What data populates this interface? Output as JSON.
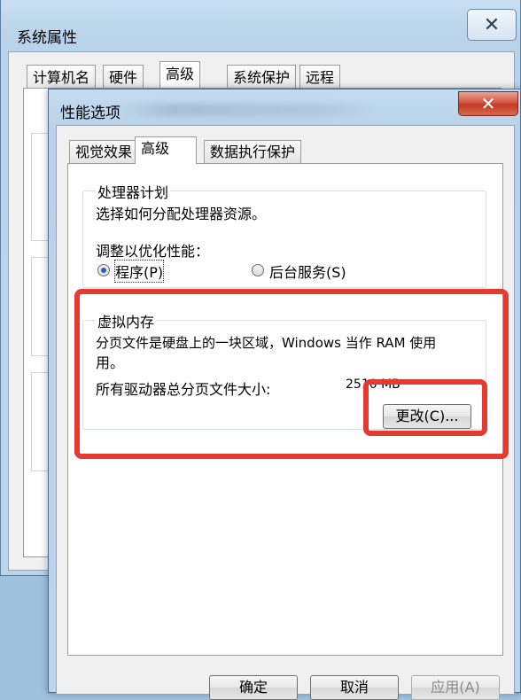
{
  "outer_window": {
    "title": "系统属性",
    "close_glyph": "✕",
    "tabs": [
      "计算机名",
      "硬件",
      "高级",
      "系统保护",
      "远程"
    ],
    "selected_tab": "高级"
  },
  "inner_window": {
    "title": "性能选项",
    "close_glyph": "✕",
    "tabs": [
      "视觉效果",
      "高级",
      "数据执行保护"
    ],
    "selected_tab": "高级",
    "processor_scheduling": {
      "title": "处理器计划",
      "description": "选择如何分配处理器资源。",
      "optimize_label": "调整以优化性能：",
      "option_programs": "程序(P)",
      "option_background": "后台服务(S)",
      "selected": "程序(P)"
    },
    "virtual_memory": {
      "title": "虚拟内存",
      "description_line1": "分页文件是硬盘上的一块区域，Windows 当作 RAM 使用",
      "description_line2": "用。",
      "total_label": "所有驱动器总分页文件大小:",
      "total_value": "2510 MB",
      "change_button": "更改(C)..."
    },
    "buttons": {
      "ok": "确定",
      "cancel": "取消",
      "apply": "应用(A)"
    }
  },
  "highlight_color": "#e43a2f"
}
